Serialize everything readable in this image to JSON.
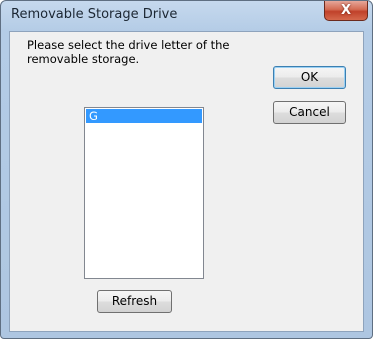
{
  "window": {
    "title": "Removable Storage Drive",
    "close_glyph": "X"
  },
  "prompt": {
    "line1": "Please select the drive letter of the",
    "line2": "removable storage."
  },
  "buttons": {
    "ok_label": "OK",
    "cancel_label": "Cancel",
    "refresh_label": "Refresh"
  },
  "drive_list": {
    "items": [
      "G"
    ],
    "selected": "G"
  },
  "colors": {
    "selection": "#3399ff",
    "titlebar": "#b9cfe8",
    "close_button": "#c7452c"
  }
}
